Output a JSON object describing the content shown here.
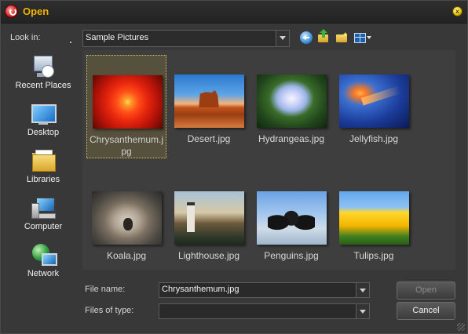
{
  "window": {
    "title": "Open",
    "close_glyph": "x"
  },
  "toolbar": {
    "look_in_label": "Look in:",
    "look_in_value": "Sample Pictures",
    "icons": [
      "back-icon",
      "up-folder-icon",
      "new-folder-icon",
      "views-menu-icon"
    ]
  },
  "places": [
    {
      "label": "Recent Places",
      "icon": "recent-places-icon"
    },
    {
      "label": "Desktop",
      "icon": "desktop-icon"
    },
    {
      "label": "Libraries",
      "icon": "libraries-icon"
    },
    {
      "label": "Computer",
      "icon": "computer-icon"
    },
    {
      "label": "Network",
      "icon": "network-icon"
    }
  ],
  "files": [
    {
      "name": "Chrysanthemum.jpg",
      "name_display": "Chrysanthemum.j\npg",
      "selected": true
    },
    {
      "name": "Desert.jpg",
      "selected": false
    },
    {
      "name": "Hydrangeas.jpg",
      "selected": false
    },
    {
      "name": "Jellyfish.jpg",
      "selected": false
    },
    {
      "name": "Koala.jpg",
      "selected": false
    },
    {
      "name": "Lighthouse.jpg",
      "selected": false
    },
    {
      "name": "Penguins.jpg",
      "selected": false
    },
    {
      "name": "Tulips.jpg",
      "selected": false
    }
  ],
  "bottom": {
    "file_name_label": "File name:",
    "file_name_value": "Chrysanthemum.jpg",
    "files_of_type_label": "Files of type:",
    "files_of_type_value": "",
    "open_label": "Open",
    "cancel_label": "Cancel"
  },
  "colors": {
    "title_text": "#f0b400",
    "selection_border": "#d8c46a",
    "background": "#383838"
  }
}
